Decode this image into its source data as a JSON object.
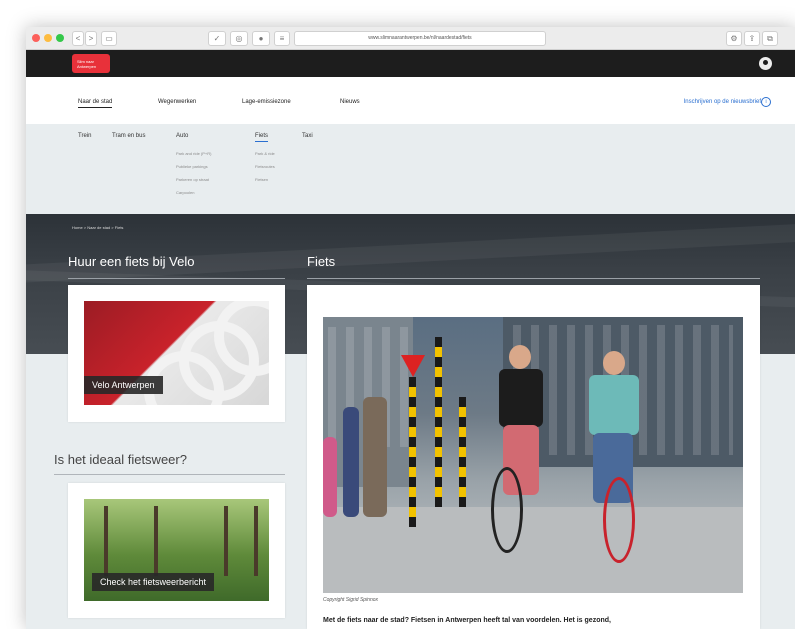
{
  "browser": {
    "url": "www.slimnaarantwerpen.be/nl/naardestad/fiets",
    "back_label": "<",
    "forward_label": ">"
  },
  "site": {
    "logo_line1": "Slim naar",
    "logo_line2": "Antwerpen"
  },
  "nav": {
    "items": [
      "Naar de stad",
      "Wegenwerken",
      "Lage-emissiezone",
      "Nieuws"
    ],
    "newsletter": "Inschrijven op de nieuwsbrief",
    "newsletter_icon": "i"
  },
  "subnav": {
    "categories": [
      "Trein",
      "Tram en bus",
      "Auto",
      "Fiets",
      "Taxi"
    ],
    "auto_links": [
      "Park and ride (P+R)",
      "Publieke parkings",
      "Parkeren op straat",
      "Carpoolen"
    ],
    "fiets_links": [
      "Park & ride",
      "Fietsroutes",
      "Fietsen"
    ]
  },
  "breadcrumb": {
    "home": "Home",
    "sep": ">",
    "level1": "Naar de stad",
    "level2": "Fiets"
  },
  "left": {
    "velo_heading": "Huur een fiets bij Velo",
    "velo_caption": "Velo Antwerpen",
    "weather_heading": "Is het ideaal fietsweer?",
    "weather_caption": "Check het fietsweerbericht"
  },
  "main": {
    "heading": "Fiets",
    "photo_credit": "Copyright Sigrid Spinnox",
    "intro": "Met de fiets naar de stad? Fietsen in Antwerpen heeft tal van voordelen. Het is gezond,"
  },
  "colors": {
    "accent": "#e8313a",
    "link": "#2a6fd0",
    "dark": "#1d1d1d",
    "panel": "#e8edef"
  }
}
